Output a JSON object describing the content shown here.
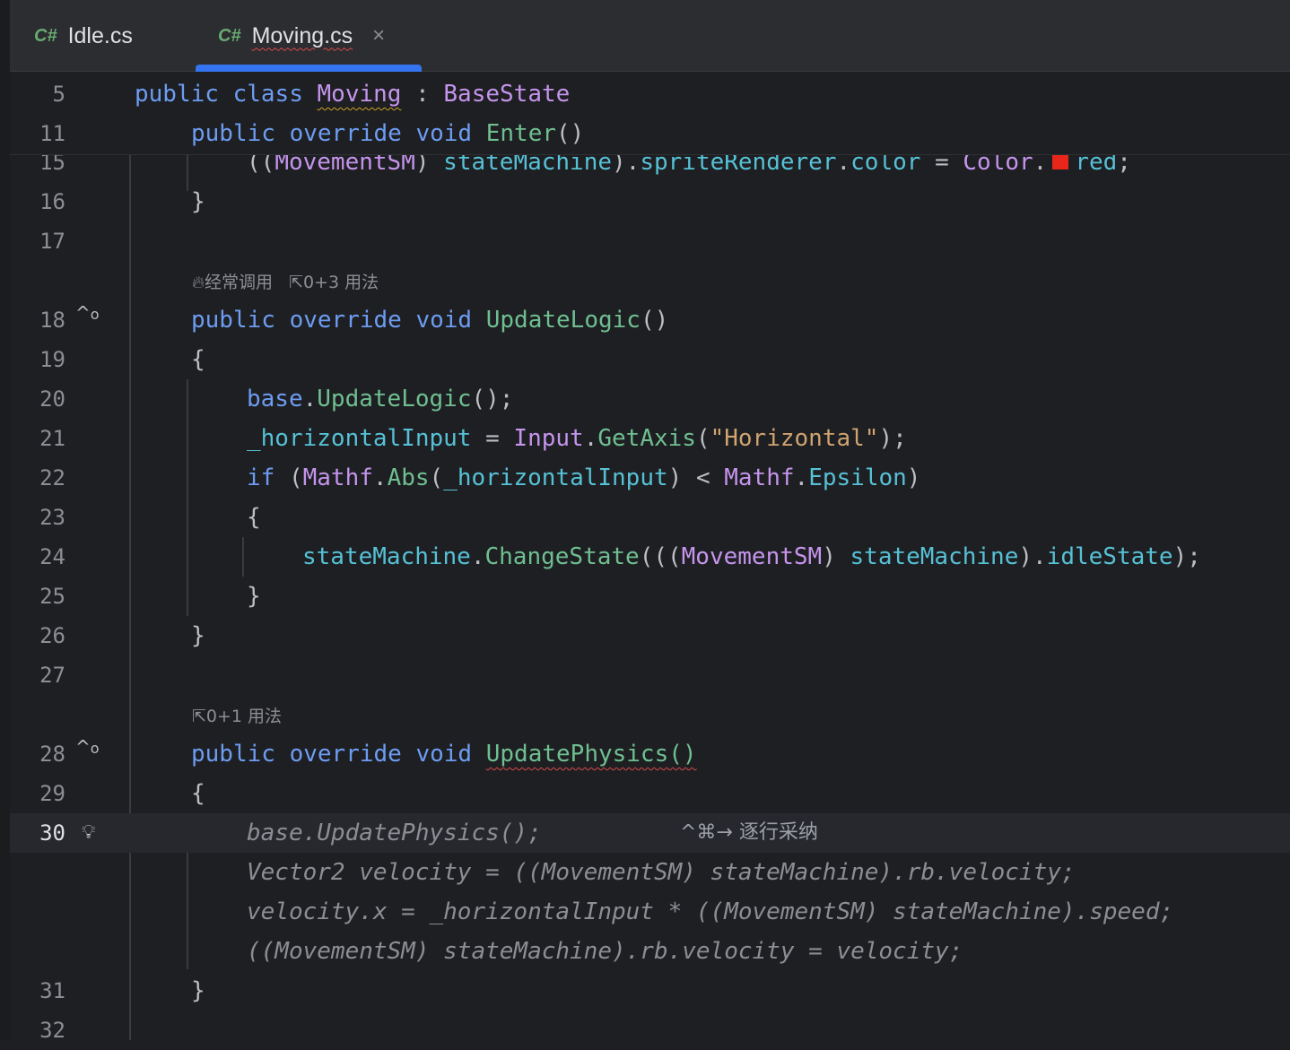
{
  "tabs": [
    {
      "lang": "C#",
      "label": "Idle.cs",
      "active": false
    },
    {
      "lang": "C#",
      "label": "Moving.cs",
      "active": true,
      "close": "×"
    }
  ],
  "sticky_lines": [
    {
      "num": "5",
      "code": "public class Moving : BaseState"
    },
    {
      "num": "11",
      "code": "public override void Enter()"
    }
  ],
  "lines": {
    "l15": {
      "num": "15"
    },
    "l16": {
      "num": "16",
      "code": "}"
    },
    "l17": {
      "num": "17"
    },
    "l18": {
      "num": "18",
      "code": "public override void UpdateLogic()"
    },
    "l19": {
      "num": "19",
      "code": "{"
    },
    "l20": {
      "num": "20",
      "code": "base.UpdateLogic();"
    },
    "l21": {
      "num": "21",
      "code": "_horizontalInput = Input.GetAxis(\"Horizontal\");"
    },
    "l22": {
      "num": "22",
      "code": "if (Mathf.Abs(_horizontalInput) < Mathf.Epsilon)"
    },
    "l23": {
      "num": "23",
      "code": "{"
    },
    "l24": {
      "num": "24",
      "code": "stateMachine.ChangeState(((MovementSM) stateMachine).idleState);"
    },
    "l25": {
      "num": "25",
      "code": "}"
    },
    "l26": {
      "num": "26",
      "code": "}"
    },
    "l27": {
      "num": "27"
    },
    "l28": {
      "num": "28",
      "code": "public override void UpdatePhysics()"
    },
    "l29": {
      "num": "29",
      "code": "{"
    },
    "l30": {
      "num": "30",
      "code": "base.UpdatePhysics();"
    },
    "l31": {
      "num": "31",
      "code": "}"
    },
    "l32": {
      "num": "32"
    }
  },
  "line15_code": {
    "p1": "((",
    "ty1": "MovementSM",
    "p2": ") ",
    "f1": "stateMachine",
    "p3": ").",
    "f2": "spriteRenderer",
    "p4": ".",
    "f3": "color",
    "p5": " = ",
    "ty2": "Color",
    "p6": ".",
    "swatch_color": "#e8261a",
    "f4": "red",
    "p7": ";"
  },
  "code_vision": {
    "updatelogic": {
      "frequent": "经常调用",
      "usages": "0+3 用法"
    },
    "updatephysics": {
      "usages": "0+1 用法"
    }
  },
  "ai_completion": {
    "shortcut": "^⌘→ 逐行采纳",
    "lines": [
      "Vector2 velocity = ((MovementSM) stateMachine).rb.velocity;",
      "velocity.x = _horizontalInput * ((MovementSM) stateMachine).speed;",
      "((MovementSM) stateMachine).rb.velocity = velocity;"
    ]
  },
  "icons": {
    "override_gutter": "override-up-arrow-icon",
    "bulb": "lightbulb-icon",
    "flame": "flame-icon",
    "usages": "usages-arrow-icon"
  }
}
